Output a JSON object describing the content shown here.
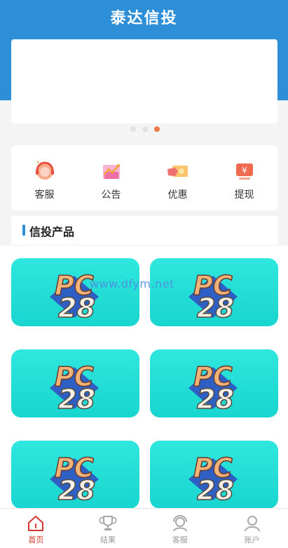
{
  "header": {
    "title": "泰达信投"
  },
  "carousel": {
    "dots": 3,
    "active_index": 2
  },
  "quick_actions": [
    {
      "label": "客服",
      "icon": "headset-icon"
    },
    {
      "label": "公告",
      "icon": "chart-icon"
    },
    {
      "label": "优惠",
      "icon": "coupon-hand-icon"
    },
    {
      "label": "提现",
      "icon": "yuan-screen-icon"
    }
  ],
  "section": {
    "title": "信投产品"
  },
  "products": [
    {
      "logo_text_top": "PC",
      "logo_text_bottom": "28"
    },
    {
      "logo_text_top": "PC",
      "logo_text_bottom": "28"
    },
    {
      "logo_text_top": "PC",
      "logo_text_bottom": "28"
    },
    {
      "logo_text_top": "PC",
      "logo_text_bottom": "28"
    },
    {
      "logo_text_top": "PC",
      "logo_text_bottom": "28"
    },
    {
      "logo_text_top": "PC",
      "logo_text_bottom": "28"
    }
  ],
  "watermark": "www.dfym.net",
  "tabbar": {
    "items": [
      {
        "label": "首页",
        "icon": "home-icon",
        "active": true
      },
      {
        "label": "结果",
        "icon": "trophy-icon",
        "active": false
      },
      {
        "label": "客服",
        "icon": "support-icon",
        "active": false
      },
      {
        "label": "账户",
        "icon": "user-icon",
        "active": false
      }
    ]
  },
  "colors": {
    "primary": "#2d8fd8",
    "active_tab": "#d4372b",
    "carousel_active": "#f07b4a",
    "card_bg": "#22ddd6"
  }
}
